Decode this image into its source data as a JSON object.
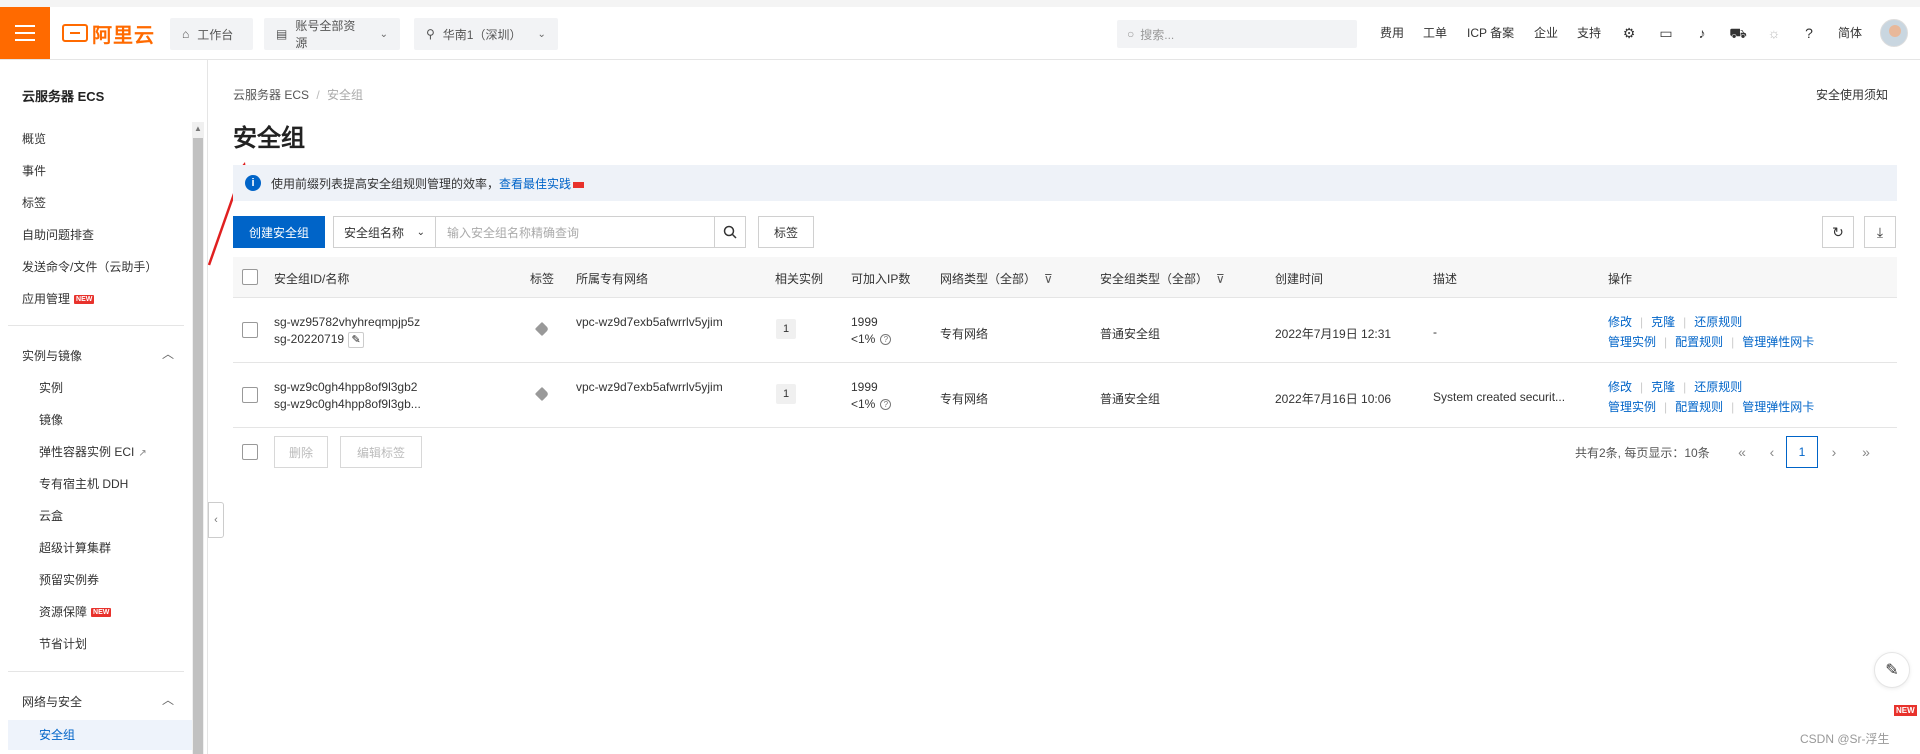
{
  "topbar": {
    "logo_text": "阿里云",
    "workbench": "工作台",
    "resources": "账号全部资源",
    "region": "华南1（深圳）",
    "search_placeholder": "搜索...",
    "links": [
      "费用",
      "工单",
      "ICP 备案",
      "企业",
      "支持"
    ],
    "lang": "简体"
  },
  "sidebar": {
    "title": "云服务器 ECS",
    "items": [
      "概览",
      "事件",
      "标签",
      "自助问题排查",
      "发送命令/文件（云助手）",
      "应用管理"
    ],
    "new_badge": "NEW",
    "group_instances": "实例与镜像",
    "instances_sub": [
      "实例",
      "镜像",
      "弹性容器实例 ECI",
      "专有宿主机 DDH",
      "云盒",
      "超级计算集群",
      "预留实例券",
      "资源保障",
      "节省计划"
    ],
    "group_network": "网络与安全",
    "network_sub": [
      "安全组"
    ]
  },
  "breadcrumb": {
    "parent": "云服务器 ECS",
    "separator": "/",
    "current": "安全组"
  },
  "help_link": "安全使用须知",
  "page_title": "安全组",
  "notice": {
    "text": "使用前缀列表提高安全组规则管理的效率，",
    "link": "查看最佳实践"
  },
  "toolbar": {
    "create": "创建安全组",
    "filter_select": "安全组名称",
    "search_placeholder": "输入安全组名称精确查询",
    "tag": "标签"
  },
  "table": {
    "headers": [
      "安全组ID/名称",
      "标签",
      "所属专有网络",
      "相关实例",
      "可加入IP数",
      "网络类型（全部）",
      "安全组类型（全部）",
      "创建时间",
      "描述",
      "操作"
    ],
    "rows": [
      {
        "id": "sg-wz95782vhyhreqmpjp5z",
        "name": "sg-20220719",
        "vpc": "vpc-wz9d7exb5afwrrlv5yjim",
        "instances": "1",
        "ip_count": "1999",
        "ip_pct": "<1%",
        "network_type": "专有网络",
        "sg_type": "普通安全组",
        "created": "2022年7月19日 12:31",
        "desc": "-",
        "ops1": [
          "修改",
          "克隆",
          "还原规则"
        ],
        "ops2": [
          "管理实例",
          "配置规则",
          "管理弹性网卡"
        ]
      },
      {
        "id": "sg-wz9c0gh4hpp8of9l3gb2",
        "name": "sg-wz9c0gh4hpp8of9l3gb...",
        "vpc": "vpc-wz9d7exb5afwrrlv5yjim",
        "instances": "1",
        "ip_count": "1999",
        "ip_pct": "<1%",
        "network_type": "专有网络",
        "sg_type": "普通安全组",
        "created": "2022年7月16日 10:06",
        "desc": "System created securit...",
        "ops1": [
          "修改",
          "克隆",
          "还原规则"
        ],
        "ops2": [
          "管理实例",
          "配置规则",
          "管理弹性网卡"
        ]
      }
    ]
  },
  "bulk": {
    "delete": "删除",
    "edit_tags": "编辑标签"
  },
  "pagination": {
    "summary": "共有2条, 每页显示：10条",
    "current_page": "1"
  },
  "watermark": "CSDN @Sr-浮生",
  "float_new": "NEW",
  "colors": {
    "brand_orange": "#ff6a00",
    "primary_blue": "#0064c8",
    "new_red": "#e8322c"
  }
}
